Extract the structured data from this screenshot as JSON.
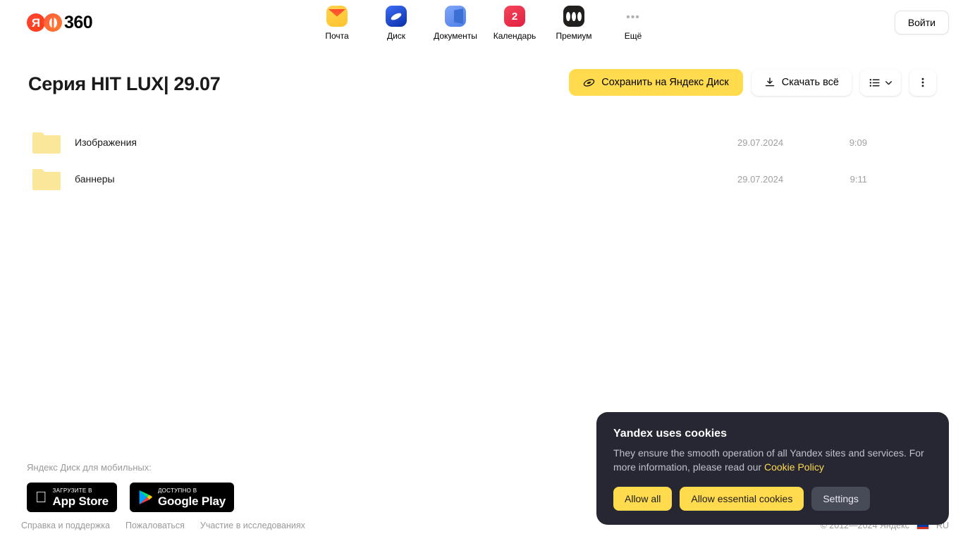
{
  "header": {
    "logo": {
      "ya_letter": "Я",
      "suffix": "360",
      "name": "yandex-360-logo"
    },
    "nav": [
      {
        "label": "Почта",
        "icon": "mail-icon",
        "badge": ""
      },
      {
        "label": "Диск",
        "icon": "disk-icon",
        "badge": ""
      },
      {
        "label": "Документы",
        "icon": "documents-icon",
        "badge": ""
      },
      {
        "label": "Календарь",
        "icon": "calendar-icon",
        "badge": "2"
      },
      {
        "label": "Премиум",
        "icon": "premium-icon",
        "badge": ""
      },
      {
        "label": "Ещё",
        "icon": "more-icon",
        "badge": ""
      }
    ],
    "login_label": "Войти"
  },
  "toolbar": {
    "page_title": "Серия HIT LUX| 29.07",
    "save_label": "Сохранить на Яндекс Диск",
    "download_label": "Скачать всё"
  },
  "filelist": {
    "rows": [
      {
        "name": "Изображения",
        "date": "29.07.2024",
        "time": "9:09",
        "type": "folder"
      },
      {
        "name": "баннеры",
        "date": "29.07.2024",
        "time": "9:11",
        "type": "folder"
      }
    ]
  },
  "promo": {
    "label": "Яндекс Диск для мобильных:",
    "appstore": {
      "small": "Загрузите в",
      "big": "App Store"
    },
    "googleplay": {
      "small": "Доступно в",
      "big": "Google Play"
    }
  },
  "footer": {
    "links": [
      "Справка и поддержка",
      "Пожаловаться",
      "Участие в исследованиях"
    ],
    "copyright": "© 2012—2024 Яндекс",
    "language": "RU"
  },
  "cookie": {
    "title": "Yandex uses cookies",
    "text_before": "They ensure the smooth operation of all Yandex sites and services. For more information, please read our ",
    "link": "Cookie Policy",
    "allow_all": "Allow all",
    "allow_essential": "Allow essential cookies",
    "settings": "Settings"
  },
  "colors": {
    "accent_yellow": "#ffdb4d",
    "folder": "#fae79a",
    "cookie_bg": "#262733",
    "brand_red": "#fc3f1d"
  }
}
